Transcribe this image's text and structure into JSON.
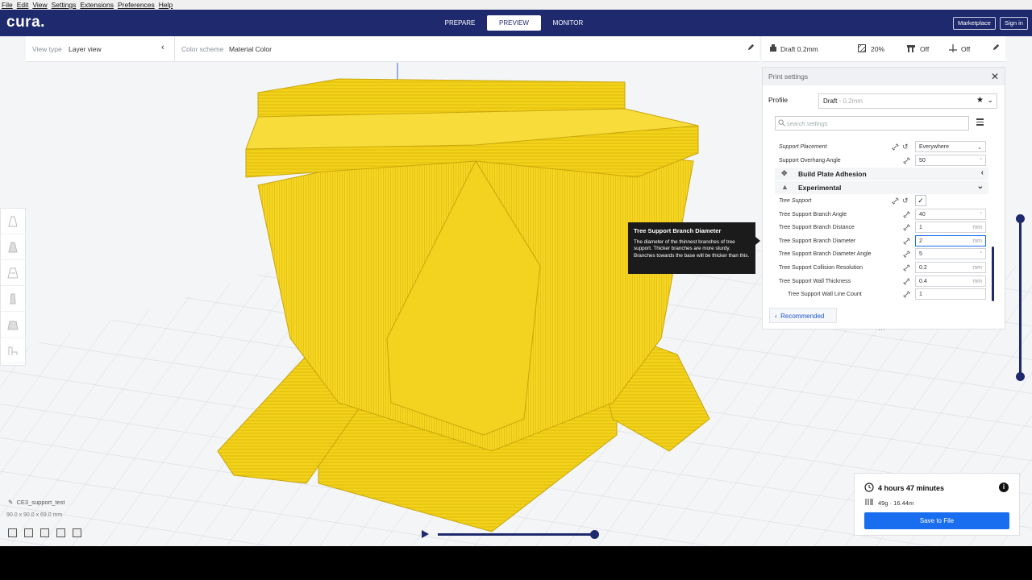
{
  "menu": [
    "File",
    "Edit",
    "View",
    "Settings",
    "Extensions",
    "Preferences",
    "Help"
  ],
  "header": {
    "logo": "cura.",
    "stages": [
      {
        "label": "PREPARE",
        "active": false
      },
      {
        "label": "PREVIEW",
        "active": true
      },
      {
        "label": "MONITOR",
        "active": false
      }
    ],
    "marketplace": "Marketplace",
    "signin": "Sign in"
  },
  "toolbar": {
    "view_type_label": "View type",
    "view_type_value": "Layer view",
    "color_scheme_label": "Color scheme",
    "color_scheme_value": "Material Color",
    "profile_summary": "Draft 0.2mm",
    "infill": "20%",
    "support": "Off",
    "adhesion": "Off"
  },
  "print_settings": {
    "title": "Print settings",
    "profile_label": "Profile",
    "profile_name": "Draft",
    "profile_suffix": "- 0.2mm",
    "search_placeholder": "search settings",
    "rows": [
      {
        "label": "Support Placement",
        "value": "Everywhere",
        "type": "select"
      },
      {
        "label": "Support Overhang Angle",
        "value": "50",
        "unit": "°"
      },
      {
        "label": "Build Plate Adhesion",
        "type": "category",
        "collapsed": true
      },
      {
        "label": "Experimental",
        "type": "category",
        "collapsed": false
      },
      {
        "label": "Tree Support",
        "type": "checkbox",
        "checked": true
      },
      {
        "label": "Tree Support Branch Angle",
        "value": "40",
        "unit": "°"
      },
      {
        "label": "Tree Support Branch Distance",
        "value": "1",
        "unit": "mm"
      },
      {
        "label": "Tree Support Branch Diameter",
        "value": "2",
        "unit": "mm"
      },
      {
        "label": "Tree Support Branch Diameter Angle",
        "value": "5",
        "unit": "°"
      },
      {
        "label": "Tree Support Collision Resolution",
        "value": "0.2",
        "unit": "mm"
      },
      {
        "label": "Tree Support Wall Thickness",
        "value": "0.4",
        "unit": "mm"
      },
      {
        "label": "Tree Support Wall Line Count",
        "value": "1",
        "unit": ""
      }
    ],
    "recommended": "Recommended"
  },
  "tooltip": {
    "title": "Tree Support Branch Diameter",
    "text": "The diameter of the thinnest branches of tree support. Thicker branches are more sturdy. Branches towards the base will be thicker than this."
  },
  "object": {
    "name": "CE3_support_test",
    "dims": "90.0 x 90.0 x 69.0 mm"
  },
  "estimate": {
    "time": "4 hours 47 minutes",
    "material": "49g · 16.44m",
    "save": "Save to File"
  },
  "colors": {
    "brand": "#1f2a6e",
    "accent": "#196ef0",
    "model": "#f5d319"
  }
}
